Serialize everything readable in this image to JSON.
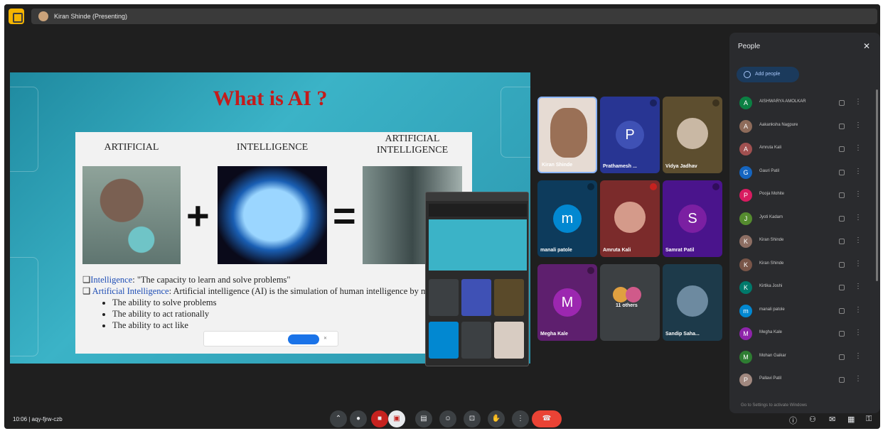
{
  "topbar": {
    "presenting_label": "Kiran Shinde (Presenting)"
  },
  "slide": {
    "title": "What is AI ?",
    "col_artificial": "ARTIFICIAL",
    "col_intelligence": "INTELLIGENCE",
    "col_ai_line1": "ARTIFICIAL",
    "col_ai_line2": "INTELLIGENCE",
    "plus": "+",
    "equals": "=",
    "bullet1_term": "Intelligence",
    "bullet1_text": ": \"The capacity to learn and solve problems\"",
    "bullet2_term": "Artificial Intelligence",
    "bullet2_text": ":  Artificial intelligence (AI) is the simulation of human intelligence by machines.",
    "sub1": "The ability to solve problems",
    "sub2": "The ability to act rationally",
    "sub3": "The ability to act like"
  },
  "tiles": [
    {
      "name": "Kiran Shinde"
    },
    {
      "name": "Prathamesh ...",
      "initial": "P",
      "color": "#3f51b5"
    },
    {
      "name": "Vidya Jadhav"
    },
    {
      "name": "manali patole",
      "initial": "m",
      "color": "#0288d1"
    },
    {
      "name": "Amruta Kali"
    },
    {
      "name": "Samrat Patil",
      "initial": "S",
      "color": "#7b1fa2"
    },
    {
      "name": "Megha Kale",
      "initial": "M",
      "color": "#9c27b0"
    },
    {
      "name": "11 others"
    },
    {
      "name": "Sandip Saha..."
    }
  ],
  "people": {
    "title": "People",
    "close": "✕",
    "add_label": "Add people",
    "rows": [
      {
        "name": "AISHWARYA AMOLKAR",
        "initial": "A",
        "color": "#0b8043"
      },
      {
        "name": "Aakanksha Nagpure",
        "initial": "A",
        "color": "#8e6b5a"
      },
      {
        "name": "Amruta Kali",
        "initial": "A",
        "color": "#a05050"
      },
      {
        "name": "Gauri Patil",
        "initial": "G",
        "color": "#1565c0"
      },
      {
        "name": "Pooja Mohite",
        "initial": "P",
        "color": "#d81b60"
      },
      {
        "name": "Jyoti Kadam",
        "initial": "J",
        "color": "#558b2f"
      },
      {
        "name": "Kiran Shinde",
        "initial": "K",
        "color": "#8d6e63"
      },
      {
        "name": "Kiran Shinde",
        "initial": "K",
        "color": "#795548"
      },
      {
        "name": "Kirtika Joshi",
        "initial": "K",
        "color": "#00796b"
      },
      {
        "name": "manali patole",
        "initial": "m",
        "color": "#0288d1"
      },
      {
        "name": "Megha Kale",
        "initial": "M",
        "color": "#8e24aa"
      },
      {
        "name": "Mohan Gaikar",
        "initial": "M",
        "color": "#2e7d32"
      },
      {
        "name": "Pallavi Patil",
        "initial": "P",
        "color": "#a1887f"
      }
    ],
    "footer": "Go to Settings to activate Windows"
  },
  "bottom": {
    "meeting_info": "10:06  |  aqy-fjrw-czb",
    "more": "⋮"
  }
}
